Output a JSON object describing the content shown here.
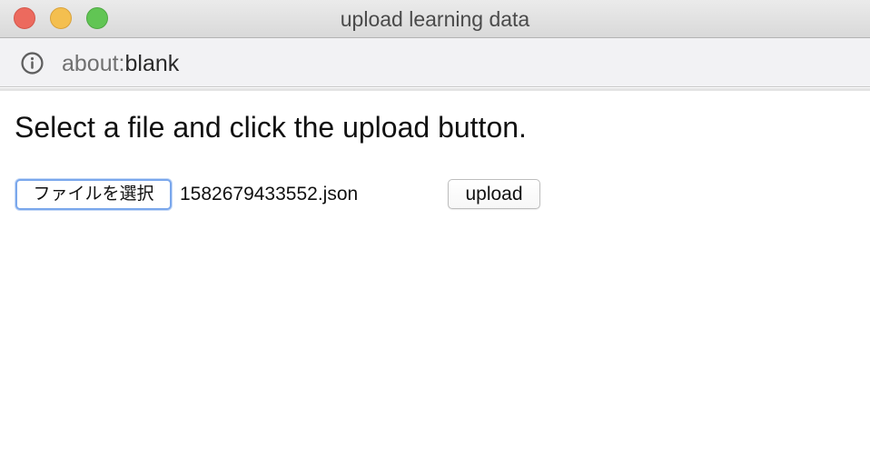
{
  "window": {
    "title": "upload learning data"
  },
  "addressbar": {
    "icon": "info-icon",
    "url_scheme": "about:",
    "url_path": "blank"
  },
  "page": {
    "instruction": "Select a file and click the upload button.",
    "file_button_label": "ファイルを選択",
    "selected_file_name": "1582679433552.json",
    "upload_button_label": "upload"
  },
  "colors": {
    "close": "#ec6a5e",
    "minimize": "#f4bf4f",
    "zoom": "#61c554",
    "focus_ring": "#7aa7ec"
  }
}
